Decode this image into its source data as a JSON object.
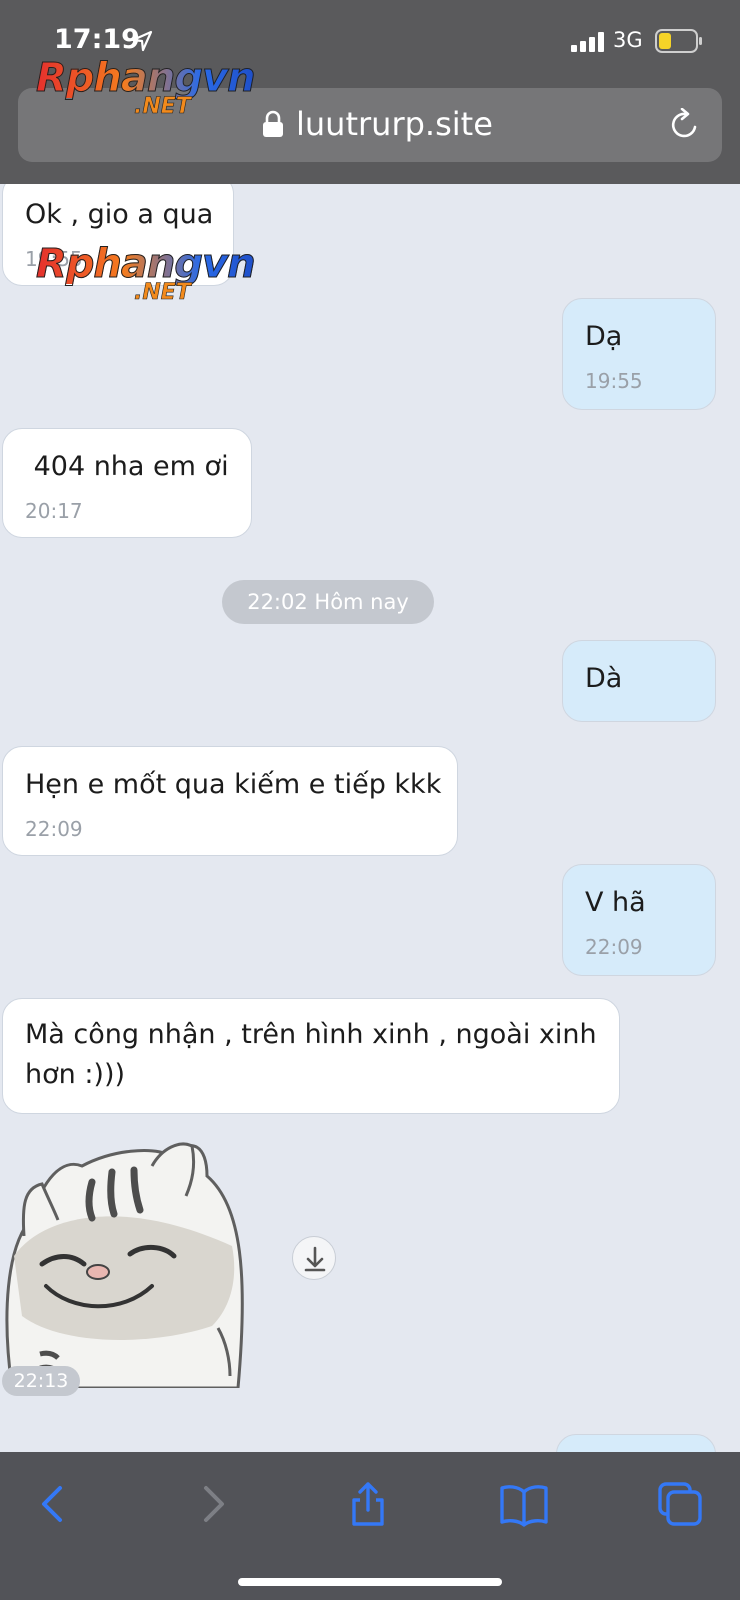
{
  "status_bar": {
    "time": "17:19",
    "network": "3G"
  },
  "browser": {
    "url": "luutrurp.site"
  },
  "watermark": {
    "brand": "Rphangvn",
    "suffix": ".NET"
  },
  "messages": [
    {
      "direction": "in",
      "text": "Ok , gio a qua",
      "time": "19:55"
    },
    {
      "direction": "out",
      "text": "Dạ",
      "time": "19:55"
    },
    {
      "direction": "in",
      "text": " 404 nha em ơi",
      "time": "20:17"
    },
    {
      "direction": "out",
      "text": "Dà",
      "time": ""
    },
    {
      "direction": "in",
      "text": "Hẹn e mốt qua kiếm e tiếp kkk",
      "time": "22:09"
    },
    {
      "direction": "out",
      "text": "V hã",
      "time": "22:09"
    },
    {
      "direction": "in",
      "text": "Mà công nhận , trên hình xinh , ngoài xinh hơn :)))",
      "time": ""
    }
  ],
  "date_separator": "22:02 Hôm nay",
  "sticker": {
    "time": "22:13"
  },
  "colors": {
    "incoming_bubble": "#ffffff",
    "outgoing_bubble": "#d6ebfa",
    "chat_background": "#e4e8f0",
    "toolbar_icon": "#3478f6"
  },
  "toolbar_icons": [
    "back-icon",
    "forward-icon",
    "share-icon",
    "bookmarks-icon",
    "tabs-icon"
  ]
}
